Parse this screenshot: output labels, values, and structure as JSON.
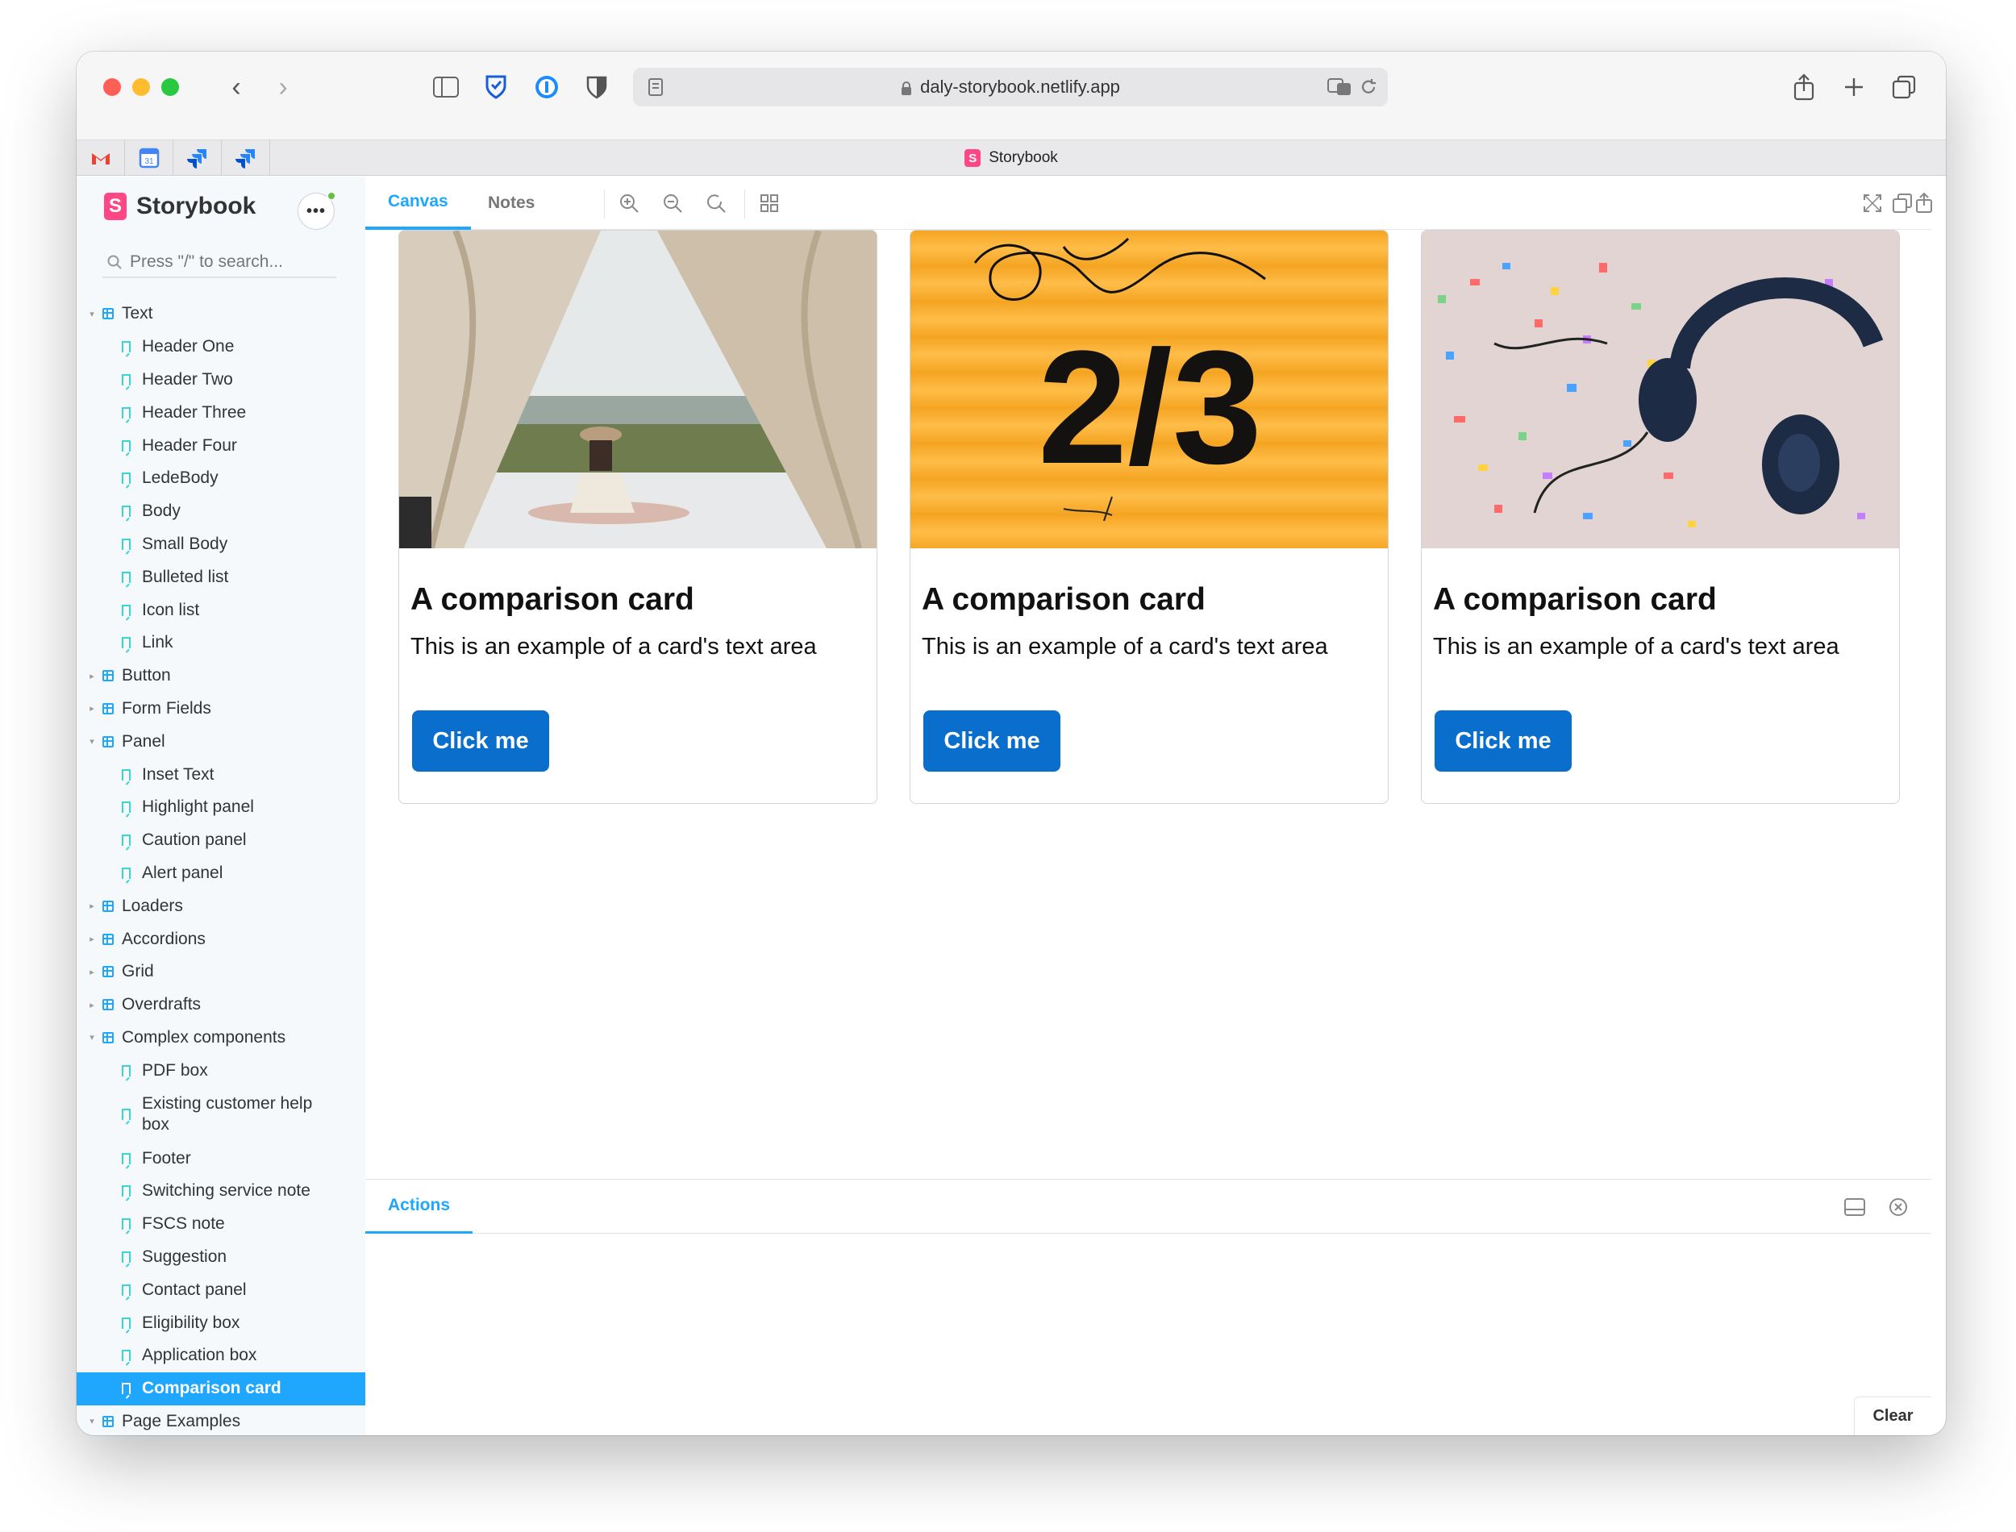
{
  "browser": {
    "url": "daly-storybook.netlify.app",
    "tab_title": "Storybook"
  },
  "sidebar": {
    "brand": "Storybook",
    "search_placeholder": "Press \"/\" to search...",
    "tree": [
      {
        "label": "Text",
        "kind": "group",
        "expanded": true
      },
      {
        "label": "Header One",
        "kind": "story"
      },
      {
        "label": "Header Two",
        "kind": "story"
      },
      {
        "label": "Header Three",
        "kind": "story"
      },
      {
        "label": "Header Four",
        "kind": "story"
      },
      {
        "label": "LedeBody",
        "kind": "story"
      },
      {
        "label": "Body",
        "kind": "story"
      },
      {
        "label": "Small Body",
        "kind": "story"
      },
      {
        "label": "Bulleted list",
        "kind": "story"
      },
      {
        "label": "Icon list",
        "kind": "story"
      },
      {
        "label": "Link",
        "kind": "story"
      },
      {
        "label": "Button",
        "kind": "group",
        "expanded": false
      },
      {
        "label": "Form Fields",
        "kind": "group",
        "expanded": false
      },
      {
        "label": "Panel",
        "kind": "group",
        "expanded": true
      },
      {
        "label": "Inset Text",
        "kind": "story"
      },
      {
        "label": "Highlight panel",
        "kind": "story"
      },
      {
        "label": "Caution panel",
        "kind": "story"
      },
      {
        "label": "Alert panel",
        "kind": "story"
      },
      {
        "label": "Loaders",
        "kind": "group",
        "expanded": false
      },
      {
        "label": "Accordions",
        "kind": "group",
        "expanded": false
      },
      {
        "label": "Grid",
        "kind": "group",
        "expanded": false
      },
      {
        "label": "Overdrafts",
        "kind": "group",
        "expanded": false
      },
      {
        "label": "Complex components",
        "kind": "group",
        "expanded": true
      },
      {
        "label": "PDF box",
        "kind": "story"
      },
      {
        "label": "Existing customer help box",
        "kind": "story",
        "wrap": true
      },
      {
        "label": "Footer",
        "kind": "story"
      },
      {
        "label": "Switching service note",
        "kind": "story"
      },
      {
        "label": "FSCS note",
        "kind": "story"
      },
      {
        "label": "Suggestion",
        "kind": "story"
      },
      {
        "label": "Contact panel",
        "kind": "story"
      },
      {
        "label": "Eligibility box",
        "kind": "story"
      },
      {
        "label": "Application box",
        "kind": "story"
      },
      {
        "label": "Comparison card",
        "kind": "story",
        "selected": true
      },
      {
        "label": "Page Examples",
        "kind": "group",
        "expanded": true
      }
    ]
  },
  "toolbar": {
    "tab_canvas": "Canvas",
    "tab_notes": "Notes"
  },
  "cards": [
    {
      "title": "A comparison card",
      "text": "This is an example of a card's text area",
      "button": "Click me",
      "image": "tent-lake-photo"
    },
    {
      "title": "A comparison card",
      "text": "This is an example of a card's text area",
      "button": "Click me",
      "image": "yellow-2-3-sign-photo",
      "image_text": "2/3"
    },
    {
      "title": "A comparison card",
      "text": "This is an example of a card's text area",
      "button": "Click me",
      "image": "headphones-confetti-photo"
    }
  ],
  "addons": {
    "tab_actions": "Actions",
    "clear_label": "Clear"
  },
  "colors": {
    "accent": "#1ea7fd",
    "button": "#0a6fcc",
    "storybook_pink": "#ff4785"
  }
}
